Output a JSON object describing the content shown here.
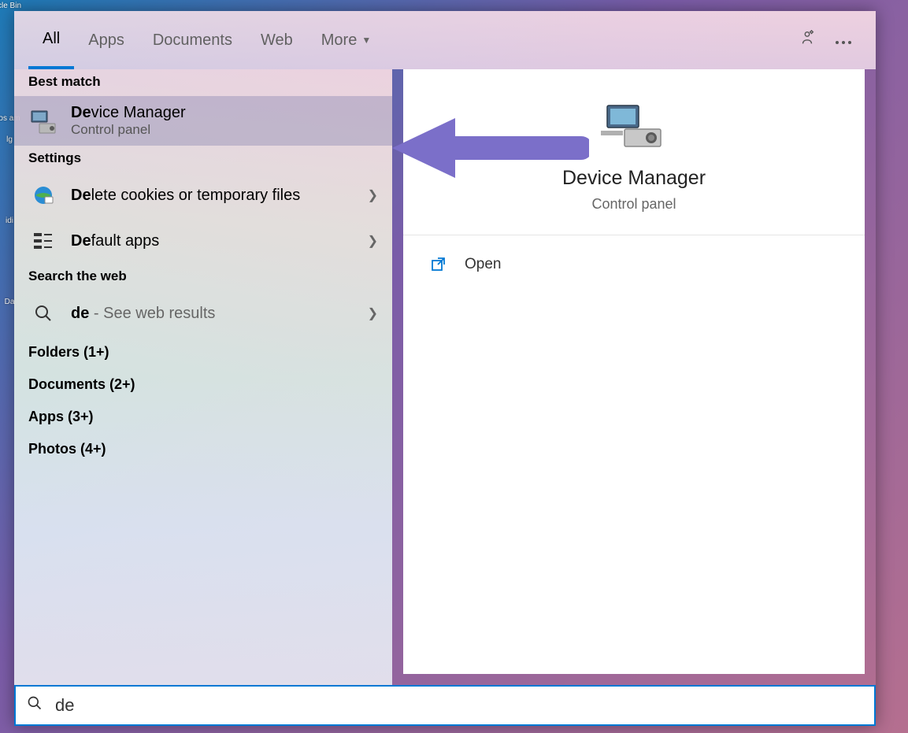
{
  "desktop": {
    "icons": [
      "cle Bin",
      "os am",
      "lg",
      "idi",
      "",
      "Da"
    ]
  },
  "tabs": {
    "items": [
      "All",
      "Apps",
      "Documents",
      "Web",
      "More"
    ],
    "active_index": 0
  },
  "left": {
    "best_match_label": "Best match",
    "best_match": {
      "title_match": "De",
      "title_rest": "vice Manager",
      "subtitle": "Control panel"
    },
    "settings_label": "Settings",
    "settings_items": [
      {
        "match": "De",
        "rest": "lete cookies or temporary files",
        "icon": "cookie"
      },
      {
        "match": "De",
        "rest": "fault apps",
        "icon": "defaults"
      }
    ],
    "search_web_label": "Search the web",
    "web_item": {
      "match": "de",
      "rest": " - See web results"
    },
    "categories": [
      "Folders (1+)",
      "Documents (2+)",
      "Apps (3+)",
      "Photos (4+)"
    ]
  },
  "preview": {
    "title": "Device Manager",
    "subtitle": "Control panel",
    "actions": [
      {
        "label": "Open",
        "icon": "open"
      }
    ]
  },
  "search": {
    "query": "de"
  }
}
